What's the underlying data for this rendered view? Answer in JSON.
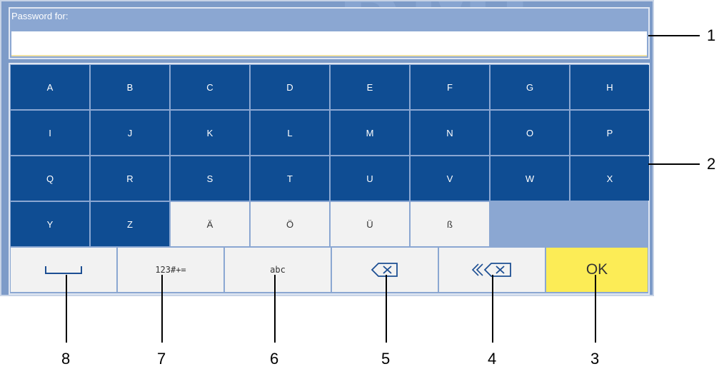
{
  "password_label": "Password for:",
  "password_value": "",
  "keyboard": {
    "rows": [
      [
        "A",
        "B",
        "C",
        "D",
        "E",
        "F",
        "G",
        "H"
      ],
      [
        "I",
        "J",
        "K",
        "L",
        "M",
        "N",
        "O",
        "P"
      ],
      [
        "Q",
        "R",
        "S",
        "T",
        "U",
        "V",
        "W",
        "X"
      ],
      [
        "Y",
        "Z",
        "Ä",
        "Ö",
        "Ü",
        "ß"
      ]
    ],
    "bottom": {
      "numeric_label": "123#+=",
      "lowercase_label": "abc",
      "ok_label": "OK"
    }
  },
  "callouts": {
    "n1": "1",
    "n2": "2",
    "n3": "3",
    "n4": "4",
    "n5": "5",
    "n6": "6",
    "n7": "7",
    "n8": "8"
  },
  "colors": {
    "key_blue": "#0f4d93",
    "key_grey": "#f2f2f2",
    "ok_yellow": "#fcec56",
    "panel_bg": "#8ba7d2"
  },
  "icons": {
    "space": "space-icon",
    "backspace": "backspace-icon",
    "clear_all": "clear-all-icon"
  }
}
